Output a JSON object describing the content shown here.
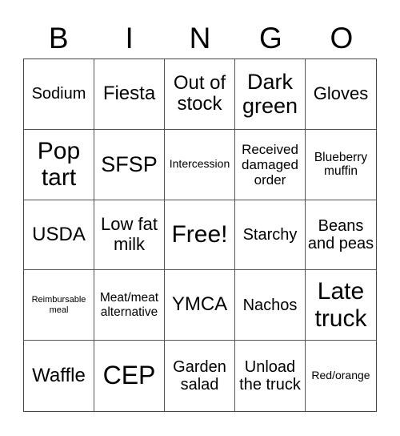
{
  "header": [
    "B",
    "I",
    "N",
    "G",
    "O"
  ],
  "cells": [
    "Sodium",
    "Fiesta",
    "Out of stock",
    "Dark green",
    "Gloves",
    "Pop tart",
    "SFSP",
    "Intercession",
    "Received damaged order",
    "Blueberry muffin",
    "USDA",
    "Low fat milk",
    "Free!",
    "Starchy",
    "Beans and peas",
    "Reimbursable meal",
    "Meat/meat alternative",
    "YMCA",
    "Nachos",
    "Late truck",
    "Waffle",
    "CEP",
    "Garden salad",
    "Unload the truck",
    "Red/orange"
  ]
}
